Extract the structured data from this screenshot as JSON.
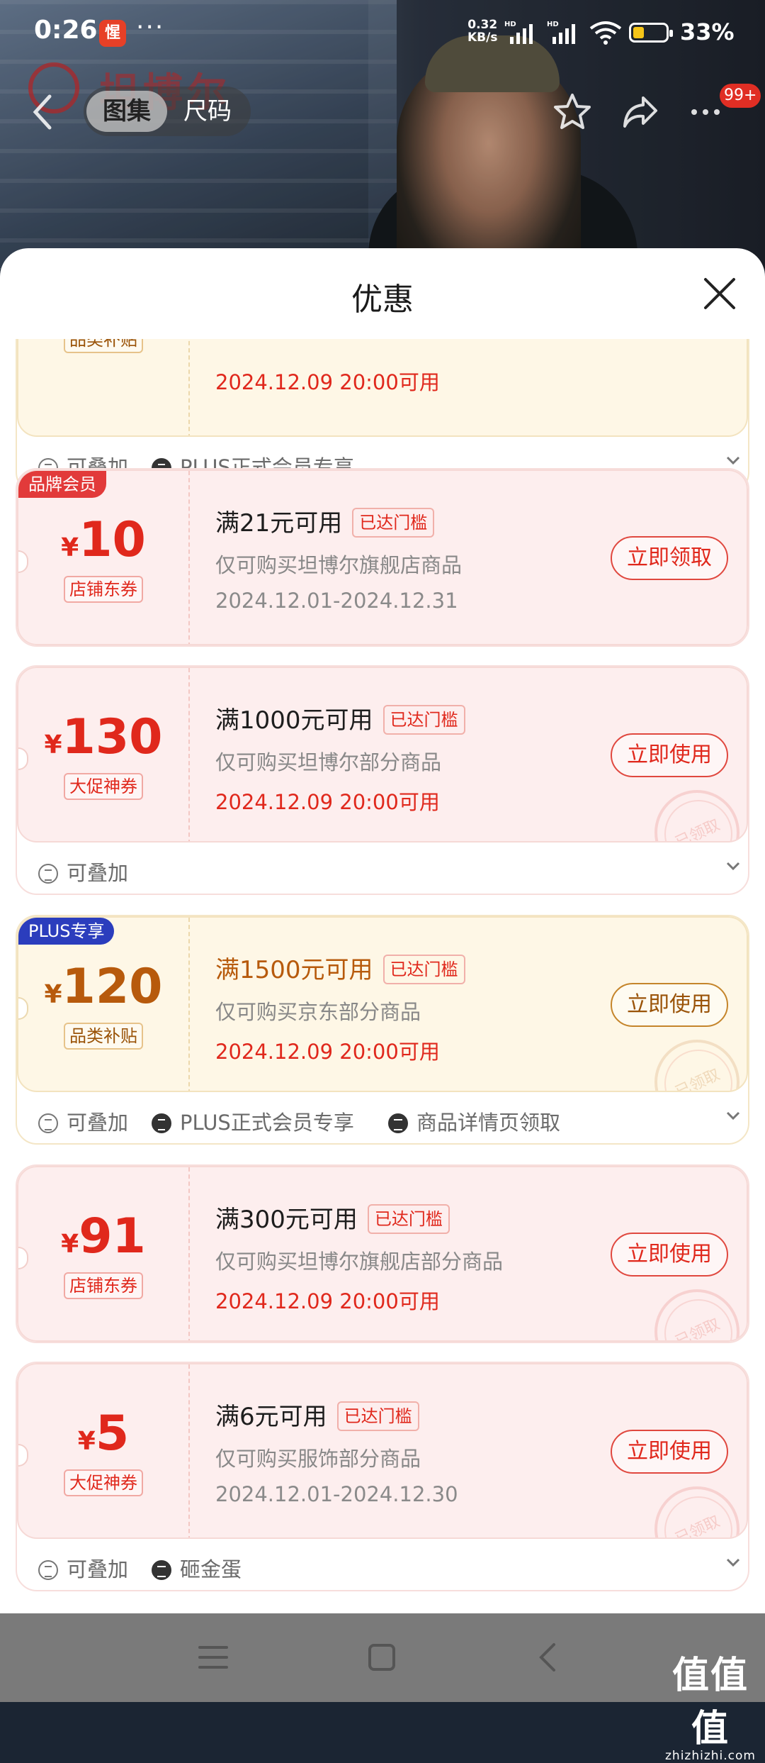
{
  "status_bar": {
    "time": "0:26",
    "app_badge": "惺",
    "dots": "···",
    "speed_value": "0.32",
    "speed_unit": "KB/s",
    "hd1": "HD",
    "hd2": "HD",
    "battery_percent": "33%",
    "battery_level": 0.33,
    "battery_color": "#f5c518"
  },
  "hero": {
    "brand_text": "坦博尔",
    "tabs": [
      {
        "label": "图集",
        "active": true
      },
      {
        "label": "尺码",
        "active": false
      }
    ],
    "message_badge": "99+"
  },
  "sheet": {
    "title": "优惠"
  },
  "coupons": [
    {
      "condition": "",
      "valid": "2024.12.09 20:00可用",
      "type_label": "品类补贴",
      "footer": [
        "可叠加",
        "PLUS正式会员专享"
      ],
      "style": "gold"
    },
    {
      "corner_tag": "品牌会员",
      "yen": "¥",
      "amount": "10",
      "type_label": "店铺东券",
      "condition": "满21元可用",
      "threshold": "已达门槛",
      "scope": "仅可购买坦博尔旗舰店商品",
      "valid": "2024.12.01-2024.12.31",
      "button": "立即领取",
      "style": "red"
    },
    {
      "yen": "¥",
      "amount": "130",
      "type_label": "大促神券",
      "condition": "满1000元可用",
      "threshold": "已达门槛",
      "scope": "仅可购买坦博尔部分商品",
      "valid": "2024.12.09 20:00可用",
      "button": "立即使用",
      "stamp": "已领取",
      "footer": [
        "可叠加"
      ],
      "style": "red"
    },
    {
      "corner_tag": "PLUS专享",
      "yen": "¥",
      "amount": "120",
      "type_label": "品类补贴",
      "condition": "满1500元可用",
      "threshold": "已达门槛",
      "scope": "仅可购买京东部分商品",
      "valid": "2024.12.09 20:00可用",
      "button": "立即使用",
      "stamp": "已领取",
      "footer": [
        "可叠加",
        "PLUS正式会员专享",
        "商品详情页领取"
      ],
      "style": "gold"
    },
    {
      "yen": "¥",
      "amount": "91",
      "type_label": "店铺东券",
      "condition": "满300元可用",
      "threshold": "已达门槛",
      "scope": "仅可购买坦博尔旗舰店部分商品",
      "valid": "2024.12.09 20:00可用",
      "button": "立即使用",
      "stamp": "已领取",
      "style": "red"
    },
    {
      "yen": "¥",
      "amount": "5",
      "type_label": "大促神券",
      "condition": "满6元可用",
      "threshold": "已达门槛",
      "scope": "仅可购买服饰部分商品",
      "valid": "2024.12.01-2024.12.30",
      "button": "立即使用",
      "stamp": "已领取",
      "footer": [
        "可叠加",
        "砸金蛋"
      ],
      "style": "red"
    }
  ],
  "watermark": {
    "main": "值值值",
    "sub": "zhizhizhi.com"
  },
  "colors": {
    "accent_red": "#e0281c",
    "accent_gold": "#b75a0c",
    "plus_blue": "#2b3dbd"
  }
}
